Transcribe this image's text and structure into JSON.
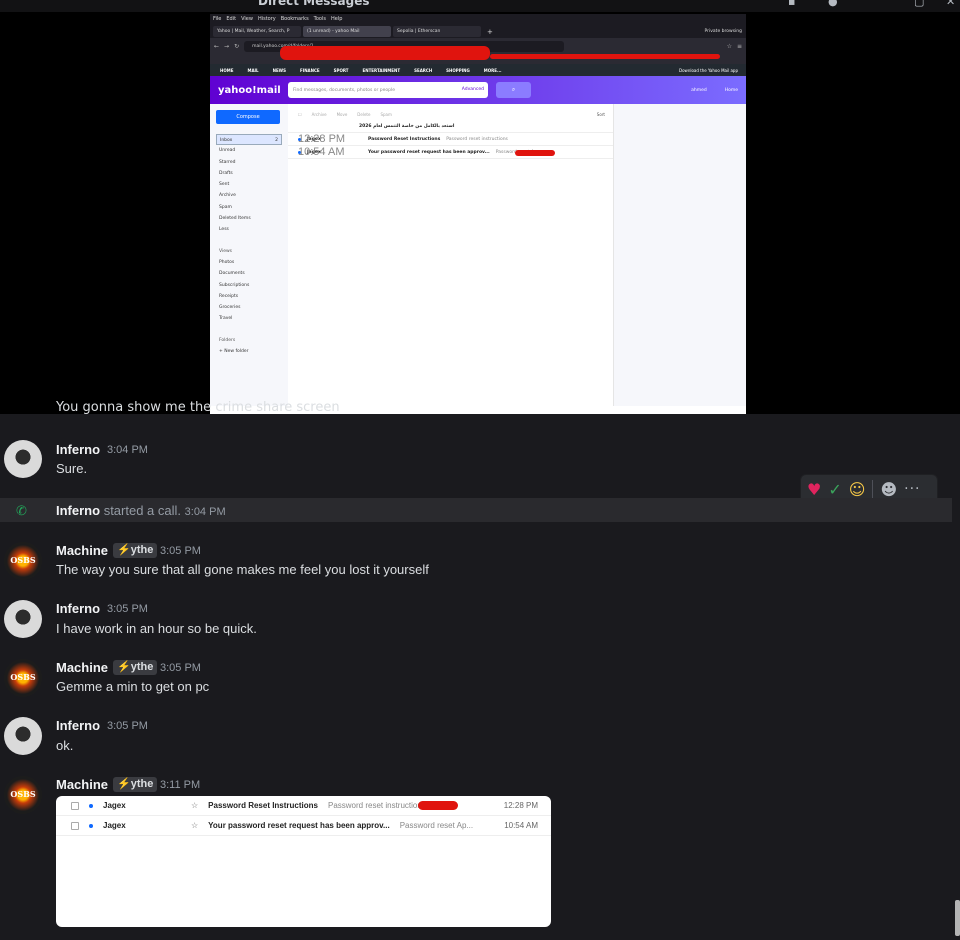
{
  "window": {
    "title": "Direct Messages"
  },
  "stream": {
    "menubar": [
      "File",
      "Edit",
      "View",
      "History",
      "Bookmarks",
      "Tools",
      "Help"
    ],
    "tabs": [
      {
        "label": "Yahoo | Mail, Weather, Search, P"
      },
      {
        "label": "(1 unread) - yahoo Mail"
      },
      {
        "label": "Sepolia | Etherscan"
      }
    ],
    "private_label": "Private browsing",
    "url": "mail.yahoo.com/d/folders/1",
    "yahoo_nav": [
      "HOME",
      "MAIL",
      "NEWS",
      "FINANCE",
      "SPORT",
      "ENTERTAINMENT",
      "SEARCH",
      "SHOPPING",
      "MORE..."
    ],
    "download_text": "Download the Yahoo Mail app",
    "logo": "yahoo!mail",
    "search_placeholder": "Find messages, documents, photos or people",
    "advanced_label": "Advanced",
    "user_name": "ahmed",
    "home_label": "Home",
    "compose_label": "Compose",
    "folders": [
      "Inbox",
      "Unread",
      "Starred",
      "Drafts",
      "Sent",
      "Archive",
      "Spam",
      "Deleted Items",
      "Less"
    ],
    "inbox_count": "2",
    "views_label": "Views",
    "views": [
      "Photos",
      "Documents",
      "Subscriptions",
      "Receipts",
      "Groceries",
      "Travel"
    ],
    "folders_label": "Folders",
    "new_folder": "+ New folder",
    "toolbar": [
      "Archive",
      "Move",
      "Delete",
      "Spam"
    ],
    "sort_label": "Sort",
    "emails": [
      {
        "from": "",
        "subject": "استعد بالكامل من خاصة التنمس لعام 2026",
        "preview": "",
        "time": ""
      },
      {
        "from": "Jagex",
        "subject": "Password Reset Instructions",
        "preview": "Password reset instructions",
        "time": "12:28 PM"
      },
      {
        "from": "Jagex",
        "subject": "Your password reset request has been approv...",
        "preview": "Password reset Ap...",
        "time": "10:54 AM"
      }
    ]
  },
  "chat": {
    "partial_line": "You gonna show me the crime share screen",
    "messages": [
      {
        "author": "Inferno",
        "time": "3:04 PM",
        "text": "Sure."
      },
      {
        "author": "Machine",
        "tag": "⚡ythe",
        "time": "3:05 PM",
        "text": "The way you sure that all gone makes me feel you lost it yourself"
      },
      {
        "author": "Inferno",
        "time": "3:05 PM",
        "text": "I have work in an hour so be quick."
      },
      {
        "author": "Machine",
        "tag": "⚡ythe",
        "time": "3:05 PM",
        "text": "Gemme a min to get on pc"
      },
      {
        "author": "Inferno",
        "time": "3:05 PM",
        "text": "ok."
      },
      {
        "author": "Machine",
        "tag": "⚡ythe",
        "time": "3:11 PM",
        "text": ""
      }
    ],
    "call": {
      "author": "Inferno",
      "text": "started a call.",
      "time": "3:04 PM"
    },
    "avatar_text": "OSBS",
    "embed_rows": [
      {
        "from": "Jagex",
        "subject": "Password Reset Instructions",
        "preview": "Password reset instructions",
        "time": "12:28 PM"
      },
      {
        "from": "Jagex",
        "subject": "Your password reset request has been approv...",
        "preview": "Password reset Ap...",
        "time": "10:54 AM"
      }
    ]
  },
  "colors": {
    "accent": "#6001d2",
    "link": "#0f69ff",
    "call_green": "#23a55a",
    "heart": "#e0245e"
  }
}
